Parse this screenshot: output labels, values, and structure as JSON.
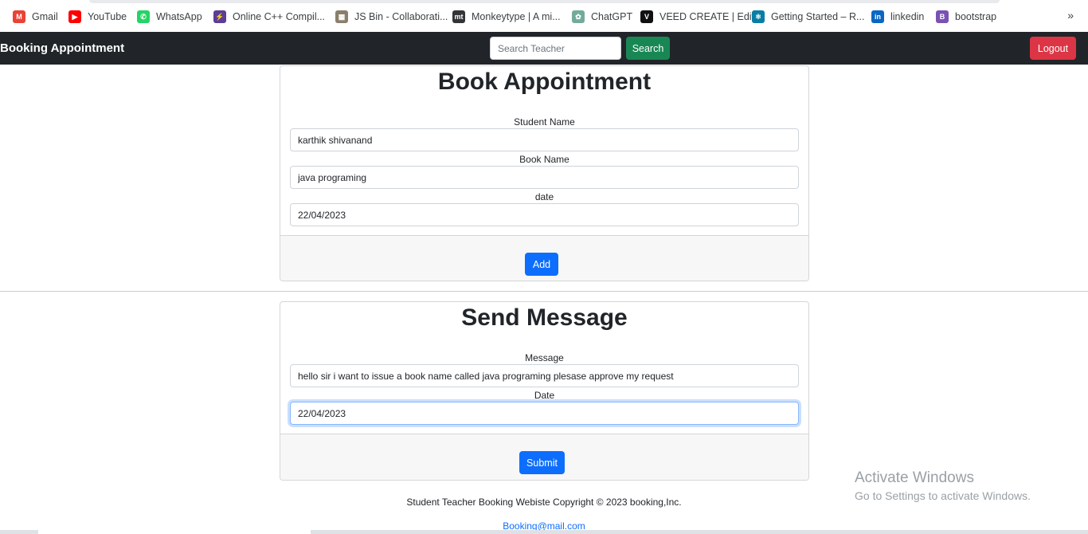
{
  "bookmarks": [
    {
      "label": "Gmail",
      "icon": "gmail-icon",
      "glyph": "M",
      "color": "#ea4335"
    },
    {
      "label": "YouTube",
      "icon": "youtube-icon",
      "glyph": "▶",
      "color": "#ff0000"
    },
    {
      "label": "WhatsApp",
      "icon": "whatsapp-icon",
      "glyph": "✆",
      "color": "#25d366"
    },
    {
      "label": "Online C++ Compil...",
      "icon": "lightning-icon",
      "glyph": "⚡",
      "color": "#5b3e96"
    },
    {
      "label": "JS Bin - Collaborati...",
      "icon": "jsbin-icon",
      "glyph": "▦",
      "color": "#8a7f6b"
    },
    {
      "label": "Monkeytype | A mi...",
      "icon": "monkeytype-icon",
      "glyph": "mt",
      "color": "#323437"
    },
    {
      "label": "ChatGPT",
      "icon": "chatgpt-icon",
      "glyph": "✿",
      "color": "#74aa9c"
    },
    {
      "label": "VEED CREATE | Edit",
      "icon": "veed-icon",
      "glyph": "V",
      "color": "#111111"
    },
    {
      "label": "Getting Started – R...",
      "icon": "react-icon",
      "glyph": "⚛",
      "color": "#087ea4"
    },
    {
      "label": "linkedin",
      "icon": "linkedin-icon",
      "glyph": "in",
      "color": "#0a66c2"
    },
    {
      "label": "bootstrap",
      "icon": "bootstrap-icon",
      "glyph": "B",
      "color": "#7952b3"
    }
  ],
  "bookmarks_overflow": "»",
  "navbar": {
    "brand": "Booking Appointment",
    "search_placeholder": "Search Teacher",
    "search_value": "",
    "search_button": "Search",
    "logout_button": "Logout"
  },
  "book_card": {
    "title": "Book Appointment",
    "student_label": "Student Name",
    "student_value": "karthik shivanand",
    "book_label": "Book Name",
    "book_value": "java programing",
    "date_label": "date",
    "date_value": "22/04/2023",
    "add_button": "Add"
  },
  "message_card": {
    "title": "Send Message",
    "message_label": "Message",
    "message_value": "hello sir i want to issue a book name called java programing plesase approve my request",
    "date_label": "Date",
    "date_value": "22/04/2023",
    "submit_button": "Submit"
  },
  "footer": {
    "text": "Student Teacher Booking Webiste Copyright © 2023 booking,Inc.",
    "email": "Booking@mail.com"
  },
  "watermark": {
    "line1": "Activate Windows",
    "line2": "Go to Settings to activate Windows."
  }
}
